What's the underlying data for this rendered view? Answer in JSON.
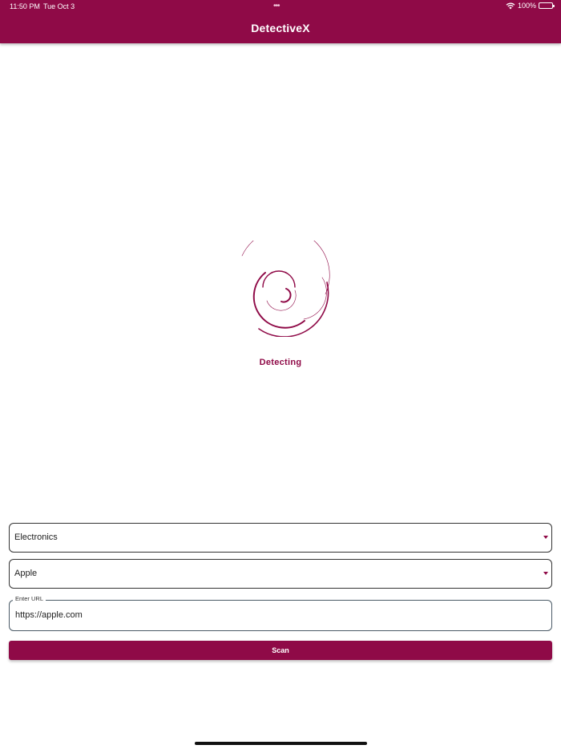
{
  "status_bar": {
    "time": "11:50 PM",
    "date": "Tue Oct 3",
    "battery": "100%",
    "icons": [
      "wifi-icon",
      "battery-icon"
    ]
  },
  "app_bar": {
    "title": "DetectiveX"
  },
  "loader": {
    "status_text": "Detecting",
    "icon": "spinner-icon"
  },
  "form": {
    "category_dropdown": {
      "value": "Electronics"
    },
    "brand_dropdown": {
      "value": "Apple"
    },
    "url_field": {
      "label": "Enter URL",
      "value": "https://apple.com"
    },
    "scan_button": {
      "label": "Scan"
    }
  },
  "colors": {
    "primary": "#8f0a47",
    "background": "#ffffff",
    "field_border": "#333333"
  }
}
